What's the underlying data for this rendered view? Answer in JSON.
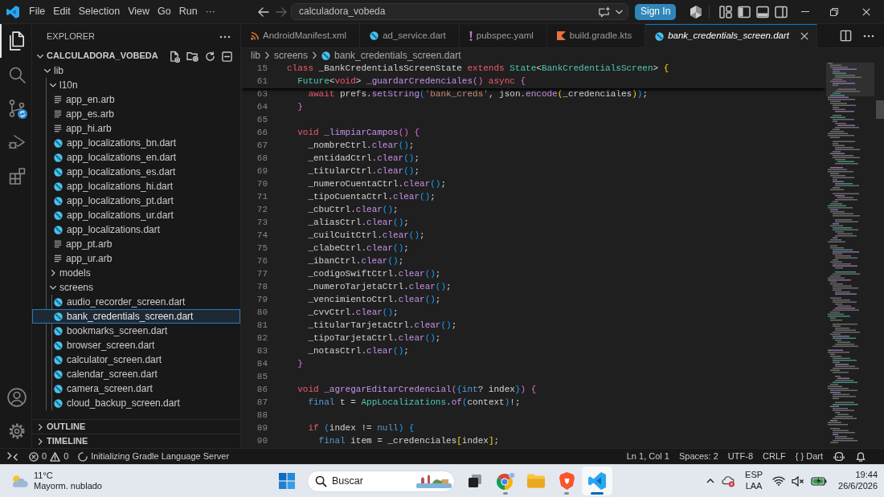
{
  "title_bar": {
    "menu": [
      "File",
      "Edit",
      "Selection",
      "View",
      "Go",
      "Run",
      "···"
    ],
    "navigation": [
      {
        "kind": "back",
        "disabled": false
      },
      {
        "kind": "forward",
        "disabled": true
      }
    ],
    "command_center": "calculadora_vobeda",
    "sign_in": "Sign In"
  },
  "activity_bar": [
    {
      "kind": "explorer",
      "selected": true
    },
    {
      "kind": "search",
      "selected": false
    },
    {
      "kind": "source_control",
      "selected": false
    },
    {
      "kind": "run_debug",
      "selected": false
    },
    {
      "kind": "extensions",
      "selected": false
    }
  ],
  "sidebar": {
    "title": "EXPLORER",
    "folder": {
      "name": "CALCULADORA_VOBEDA",
      "expanded": true
    },
    "tree": [
      {
        "name": "lib",
        "kind": "folder",
        "expanded": true,
        "selected": false,
        "children": [
          {
            "name": "l10n",
            "kind": "folder",
            "expanded": true,
            "selected": false,
            "children": [
              {
                "name": "app_en.arb",
                "kind": "arb",
                "selected": false
              },
              {
                "name": "app_es.arb",
                "kind": "arb",
                "selected": false
              },
              {
                "name": "app_hi.arb",
                "kind": "arb",
                "selected": false
              },
              {
                "name": "app_localizations_bn.dart",
                "kind": "dart",
                "selected": false
              },
              {
                "name": "app_localizations_en.dart",
                "kind": "dart",
                "selected": false
              },
              {
                "name": "app_localizations_es.dart",
                "kind": "dart",
                "selected": false
              },
              {
                "name": "app_localizations_hi.dart",
                "kind": "dart",
                "selected": false
              },
              {
                "name": "app_localizations_pt.dart",
                "kind": "dart",
                "selected": false
              },
              {
                "name": "app_localizations_ur.dart",
                "kind": "dart",
                "selected": false
              },
              {
                "name": "app_localizations.dart",
                "kind": "dart",
                "selected": false
              },
              {
                "name": "app_pt.arb",
                "kind": "arb",
                "selected": false
              },
              {
                "name": "app_ur.arb",
                "kind": "arb",
                "selected": false
              }
            ]
          },
          {
            "name": "models",
            "kind": "folder",
            "expanded": false,
            "selected": false
          },
          {
            "name": "screens",
            "kind": "folder",
            "expanded": true,
            "selected": false,
            "children": [
              {
                "name": "audio_recorder_screen.dart",
                "kind": "dart",
                "selected": false
              },
              {
                "name": "bank_credentials_screen.dart",
                "kind": "dart",
                "selected": true
              },
              {
                "name": "bookmarks_screen.dart",
                "kind": "dart",
                "selected": false
              },
              {
                "name": "browser_screen.dart",
                "kind": "dart",
                "selected": false
              },
              {
                "name": "calculator_screen.dart",
                "kind": "dart",
                "selected": false
              },
              {
                "name": "calendar_screen.dart",
                "kind": "dart",
                "selected": false
              },
              {
                "name": "camera_screen.dart",
                "kind": "dart",
                "selected": false
              },
              {
                "name": "cloud_backup_screen.dart",
                "kind": "dart",
                "selected": false
              }
            ]
          }
        ]
      }
    ],
    "sections": [
      {
        "name": "OUTLINE",
        "expanded": false
      },
      {
        "name": "TIMELINE",
        "expanded": false
      }
    ]
  },
  "tabs": [
    {
      "label": "AndroidManifest.xml",
      "kind": "xml",
      "selected": false,
      "preview": false
    },
    {
      "label": "ad_service.dart",
      "kind": "dart",
      "selected": false,
      "preview": false
    },
    {
      "label": "pubspec.yaml",
      "kind": "yaml",
      "selected": false,
      "preview": false
    },
    {
      "label": "build.gradle.kts",
      "kind": "kotlin",
      "selected": false,
      "preview": false
    },
    {
      "label": "bank_credentials_screen.dart",
      "kind": "dart",
      "selected": true,
      "preview": true
    }
  ],
  "breadcrumb": [
    "lib",
    "screens",
    "bank_credentials_screen.dart"
  ],
  "editor": {
    "sticky_lines": [
      {
        "number": "15",
        "tokens": [
          {
            "text": "class",
            "kind": "keyword"
          },
          {
            "text": " _BankCredentialsScreenState ",
            "kind": "plain"
          },
          {
            "text": "extends",
            "kind": "keyword"
          },
          {
            "text": " State",
            "kind": "type"
          },
          {
            "text": "<",
            "kind": "plain"
          },
          {
            "text": "BankCredentialsScreen",
            "kind": "type"
          },
          {
            "text": "> ",
            "kind": "plain"
          },
          {
            "text": "{",
            "kind": "bracket1"
          }
        ]
      },
      {
        "number": "61",
        "tokens": [
          {
            "text": "  Future",
            "kind": "type"
          },
          {
            "text": "<",
            "kind": "plain"
          },
          {
            "text": "void",
            "kind": "keyword"
          },
          {
            "text": "> ",
            "kind": "plain"
          },
          {
            "text": "_guardarCredenciales",
            "kind": "function"
          },
          {
            "text": "()",
            "kind": "bracket2"
          },
          {
            "text": " async",
            "kind": "keyword"
          },
          {
            "text": " {",
            "kind": "bracket2"
          }
        ]
      }
    ],
    "lines": [
      {
        "number": "63",
        "tokens": [
          {
            "text": "    await",
            "kind": "keyword"
          },
          {
            "text": " prefs.",
            "kind": "plain"
          },
          {
            "text": "setString",
            "kind": "function"
          },
          {
            "text": "(",
            "kind": "bracket3"
          },
          {
            "text": "'bank_creds'",
            "kind": "string"
          },
          {
            "text": ", json.",
            "kind": "plain"
          },
          {
            "text": "encode",
            "kind": "function"
          },
          {
            "text": "(",
            "kind": "bracket1"
          },
          {
            "text": "_credenciales",
            "kind": "plain"
          },
          {
            "text": ")",
            "kind": "bracket1"
          },
          {
            "text": ")",
            "kind": "bracket3"
          },
          {
            "text": ";",
            "kind": "plain"
          }
        ]
      },
      {
        "number": "64",
        "tokens": [
          {
            "text": "  }",
            "kind": "bracket2"
          }
        ]
      },
      {
        "number": "65"
      },
      {
        "number": "66",
        "tokens": [
          {
            "text": "  void",
            "kind": "keyword"
          },
          {
            "text": " _limpiarCampos",
            "kind": "function"
          },
          {
            "text": "()",
            "kind": "bracket2"
          },
          {
            "text": " {",
            "kind": "bracket2"
          }
        ]
      },
      {
        "number": "67",
        "tokens": [
          {
            "text": "    _nombreCtrl.",
            "kind": "plain"
          },
          {
            "text": "clear",
            "kind": "function"
          },
          {
            "text": "()",
            "kind": "bracket3"
          },
          {
            "text": ";",
            "kind": "plain"
          }
        ]
      },
      {
        "number": "68",
        "tokens": [
          {
            "text": "    _entidadCtrl.",
            "kind": "plain"
          },
          {
            "text": "clear",
            "kind": "function"
          },
          {
            "text": "()",
            "kind": "bracket3"
          },
          {
            "text": ";",
            "kind": "plain"
          }
        ]
      },
      {
        "number": "69",
        "tokens": [
          {
            "text": "    _titularCtrl.",
            "kind": "plain"
          },
          {
            "text": "clear",
            "kind": "function"
          },
          {
            "text": "()",
            "kind": "bracket3"
          },
          {
            "text": ";",
            "kind": "plain"
          }
        ]
      },
      {
        "number": "70",
        "tokens": [
          {
            "text": "    _numeroCuentaCtrl.",
            "kind": "plain"
          },
          {
            "text": "clear",
            "kind": "function"
          },
          {
            "text": "()",
            "kind": "bracket3"
          },
          {
            "text": ";",
            "kind": "plain"
          }
        ]
      },
      {
        "number": "71",
        "tokens": [
          {
            "text": "    _tipoCuentaCtrl.",
            "kind": "plain"
          },
          {
            "text": "clear",
            "kind": "function"
          },
          {
            "text": "()",
            "kind": "bracket3"
          },
          {
            "text": ";",
            "kind": "plain"
          }
        ]
      },
      {
        "number": "72",
        "tokens": [
          {
            "text": "    _cbuCtrl.",
            "kind": "plain"
          },
          {
            "text": "clear",
            "kind": "function"
          },
          {
            "text": "()",
            "kind": "bracket3"
          },
          {
            "text": ";",
            "kind": "plain"
          }
        ]
      },
      {
        "number": "73",
        "tokens": [
          {
            "text": "    _aliasCtrl.",
            "kind": "plain"
          },
          {
            "text": "clear",
            "kind": "function"
          },
          {
            "text": "()",
            "kind": "bracket3"
          },
          {
            "text": ";",
            "kind": "plain"
          }
        ]
      },
      {
        "number": "74",
        "tokens": [
          {
            "text": "    _cuilCuitCtrl.",
            "kind": "plain"
          },
          {
            "text": "clear",
            "kind": "function"
          },
          {
            "text": "()",
            "kind": "bracket3"
          },
          {
            "text": ";",
            "kind": "plain"
          }
        ]
      },
      {
        "number": "75",
        "tokens": [
          {
            "text": "    _clabeCtrl.",
            "kind": "plain"
          },
          {
            "text": "clear",
            "kind": "function"
          },
          {
            "text": "()",
            "kind": "bracket3"
          },
          {
            "text": ";",
            "kind": "plain"
          }
        ]
      },
      {
        "number": "76",
        "tokens": [
          {
            "text": "    _ibanCtrl.",
            "kind": "plain"
          },
          {
            "text": "clear",
            "kind": "function"
          },
          {
            "text": "()",
            "kind": "bracket3"
          },
          {
            "text": ";",
            "kind": "plain"
          }
        ]
      },
      {
        "number": "77",
        "tokens": [
          {
            "text": "    _codigoSwiftCtrl.",
            "kind": "plain"
          },
          {
            "text": "clear",
            "kind": "function"
          },
          {
            "text": "()",
            "kind": "bracket3"
          },
          {
            "text": ";",
            "kind": "plain"
          }
        ]
      },
      {
        "number": "78",
        "tokens": [
          {
            "text": "    _numeroTarjetaCtrl.",
            "kind": "plain"
          },
          {
            "text": "clear",
            "kind": "function"
          },
          {
            "text": "()",
            "kind": "bracket3"
          },
          {
            "text": ";",
            "kind": "plain"
          }
        ]
      },
      {
        "number": "79",
        "tokens": [
          {
            "text": "    _vencimientoCtrl.",
            "kind": "plain"
          },
          {
            "text": "clear",
            "kind": "function"
          },
          {
            "text": "()",
            "kind": "bracket3"
          },
          {
            "text": ";",
            "kind": "plain"
          }
        ]
      },
      {
        "number": "80",
        "tokens": [
          {
            "text": "    _cvvCtrl.",
            "kind": "plain"
          },
          {
            "text": "clear",
            "kind": "function"
          },
          {
            "text": "()",
            "kind": "bracket3"
          },
          {
            "text": ";",
            "kind": "plain"
          }
        ]
      },
      {
        "number": "81",
        "tokens": [
          {
            "text": "    _titularTarjetaCtrl.",
            "kind": "plain"
          },
          {
            "text": "clear",
            "kind": "function"
          },
          {
            "text": "()",
            "kind": "bracket3"
          },
          {
            "text": ";",
            "kind": "plain"
          }
        ]
      },
      {
        "number": "82",
        "tokens": [
          {
            "text": "    _tipoTarjetaCtrl.",
            "kind": "plain"
          },
          {
            "text": "clear",
            "kind": "function"
          },
          {
            "text": "()",
            "kind": "bracket3"
          },
          {
            "text": ";",
            "kind": "plain"
          }
        ]
      },
      {
        "number": "83",
        "tokens": [
          {
            "text": "    _notasCtrl.",
            "kind": "plain"
          },
          {
            "text": "clear",
            "kind": "function"
          },
          {
            "text": "()",
            "kind": "bracket3"
          },
          {
            "text": ";",
            "kind": "plain"
          }
        ]
      },
      {
        "number": "84",
        "tokens": [
          {
            "text": "  }",
            "kind": "bracket2"
          }
        ]
      },
      {
        "number": "85"
      },
      {
        "number": "86",
        "tokens": [
          {
            "text": "  void",
            "kind": "keyword"
          },
          {
            "text": " _agregarEditarCredencial",
            "kind": "function"
          },
          {
            "text": "(",
            "kind": "bracket2"
          },
          {
            "text": "{",
            "kind": "bracket3"
          },
          {
            "text": "int",
            "kind": "builtin"
          },
          {
            "text": "? index",
            "kind": "plain"
          },
          {
            "text": "}",
            "kind": "bracket3"
          },
          {
            "text": ")",
            "kind": "bracket2"
          },
          {
            "text": " {",
            "kind": "bracket2"
          }
        ]
      },
      {
        "number": "87",
        "tokens": [
          {
            "text": "    final",
            "kind": "builtin"
          },
          {
            "text": " t = ",
            "kind": "plain"
          },
          {
            "text": "AppLocalizations",
            "kind": "type"
          },
          {
            "text": ".",
            "kind": "plain"
          },
          {
            "text": "of",
            "kind": "function"
          },
          {
            "text": "(",
            "kind": "bracket3"
          },
          {
            "text": "context",
            "kind": "plain"
          },
          {
            "text": ")",
            "kind": "bracket3"
          },
          {
            "text": "!;",
            "kind": "plain"
          }
        ]
      },
      {
        "number": "88"
      },
      {
        "number": "89",
        "tokens": [
          {
            "text": "    if",
            "kind": "keyword"
          },
          {
            "text": " (",
            "kind": "bracket3"
          },
          {
            "text": "index != ",
            "kind": "plain"
          },
          {
            "text": "null",
            "kind": "builtin"
          },
          {
            "text": ")",
            "kind": "bracket3"
          },
          {
            "text": " {",
            "kind": "bracket3"
          }
        ]
      },
      {
        "number": "90",
        "tokens": [
          {
            "text": "      final",
            "kind": "builtin"
          },
          {
            "text": " item = _credenciales",
            "kind": "plain"
          },
          {
            "text": "[",
            "kind": "bracket1"
          },
          {
            "text": "index",
            "kind": "plain"
          },
          {
            "text": "]",
            "kind": "bracket1"
          },
          {
            "text": ";",
            "kind": "plain"
          }
        ]
      }
    ]
  },
  "status_bar": {
    "errors": "0",
    "warnings": "0",
    "message": "Initializing Gradle Language Server",
    "items": [
      "Ln 1, Col 1",
      "Spaces: 2",
      "UTF-8",
      "CRLF"
    ],
    "language": {
      "icon": "{ }",
      "label": "Dart"
    }
  },
  "taskbar": {
    "weather": {
      "temperature": "11°C",
      "condition": "Mayorm. nublado"
    },
    "search": {
      "placeholder": "Buscar"
    },
    "apps": [
      {
        "kind": "task_view",
        "running": false,
        "active": false
      },
      {
        "kind": "chrome",
        "running": true,
        "active": false
      },
      {
        "kind": "files",
        "running": false,
        "active": false
      },
      {
        "kind": "brave",
        "running": true,
        "active": false
      },
      {
        "kind": "vscode",
        "running": true,
        "active": true
      }
    ],
    "tray": {
      "input_language": [
        "ESP",
        "LAA"
      ],
      "muted": true,
      "time": "19:44",
      "date": "26/6/2026"
    }
  }
}
